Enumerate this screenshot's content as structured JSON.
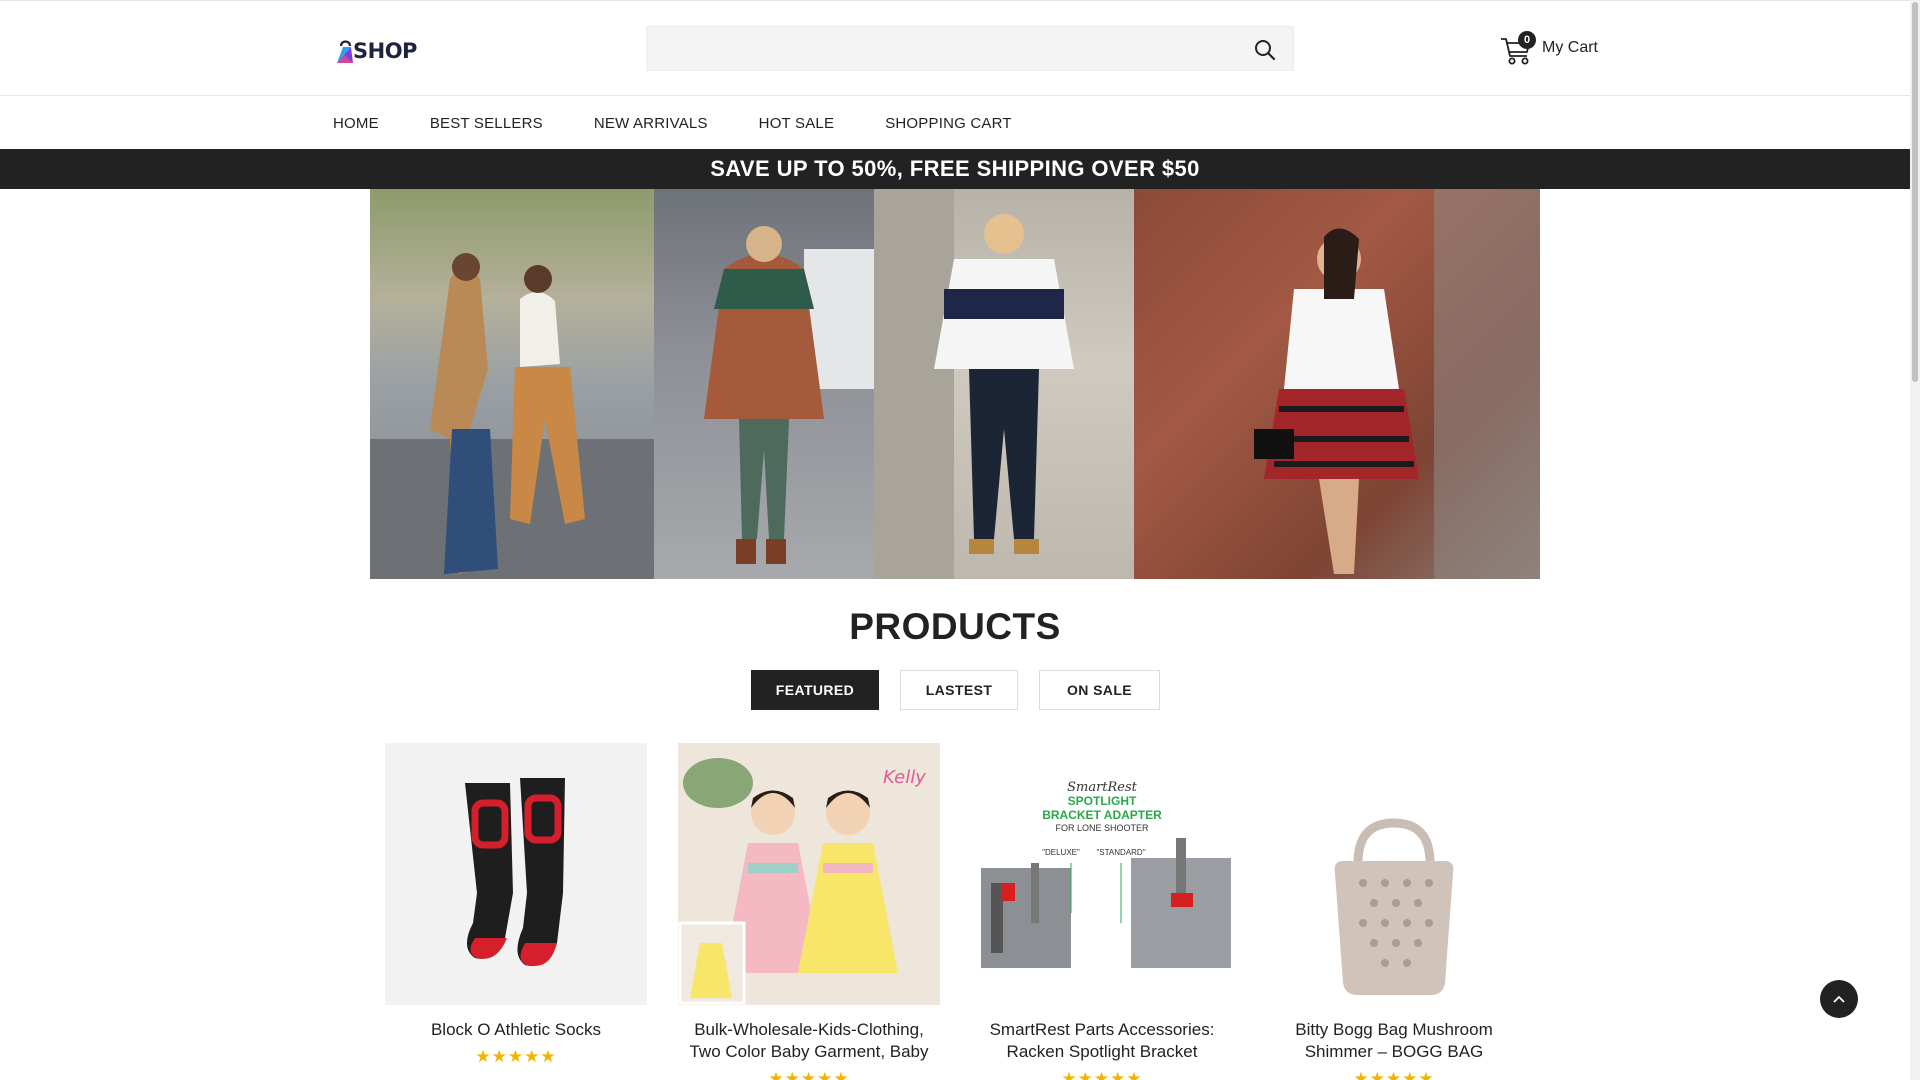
{
  "header": {
    "logo_text": "SHOP",
    "search_placeholder": "",
    "cart": {
      "count": "0",
      "label": "My Cart"
    }
  },
  "nav": {
    "items": [
      "HOME",
      "BEST SELLERS",
      "NEW ARRIVALS",
      "HOT SALE",
      "SHOPPING CART"
    ]
  },
  "promo": {
    "text": "SAVE UP TO 50%, FREE SHIPPING OVER $50"
  },
  "products": {
    "title": "PRODUCTS",
    "tabs": [
      {
        "label": "FEATURED",
        "active": true
      },
      {
        "label": "LASTEST",
        "active": false
      },
      {
        "label": "ON SALE",
        "active": false
      }
    ],
    "items": [
      {
        "name": "Block O Athletic Socks",
        "stars": "★★★★★"
      },
      {
        "name": "Bulk-Wholesale-Kids-Clothing, Two Color Baby Garment, Baby",
        "stars": "★★★★★"
      },
      {
        "name": "SmartRest Parts Accessories: Racken Spotlight Bracket",
        "stars": "★★★★★"
      },
      {
        "name": "Bitty Bogg Bag Mushroom Shimmer – BOGG BAG",
        "stars": "★★★★★"
      }
    ],
    "image_text": {
      "smartrest_brand": "SmartRest",
      "smartrest_line1": "SPOTLIGHT",
      "smartrest_line2": "BRACKET ADAPTER",
      "smartrest_line3": "FOR LONE SHOOTER",
      "smartrest_deluxe": "\"DELUXE\"",
      "smartrest_standard": "\"STANDARD\""
    }
  },
  "colors": {
    "dark": "#222222",
    "star": "#f5b301",
    "search_bg": "#f4f4f4",
    "smartrest_green": "#2aa84a"
  }
}
